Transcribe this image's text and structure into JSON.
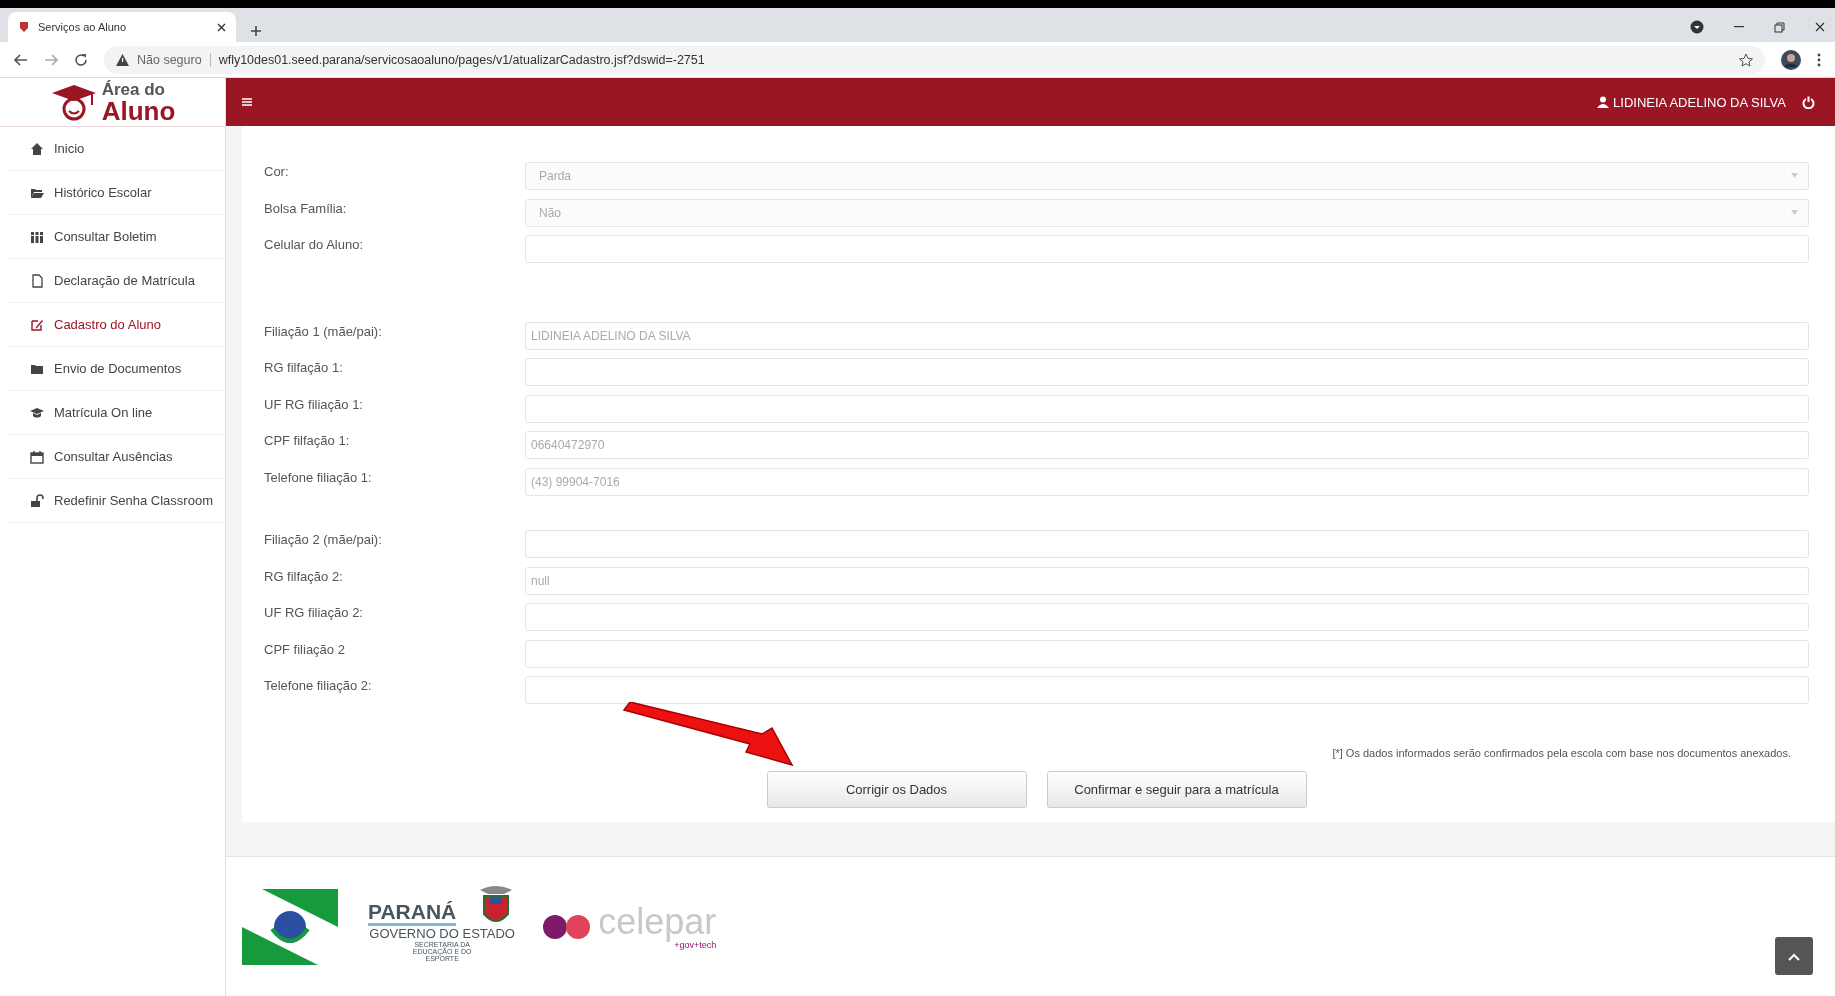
{
  "browser": {
    "tab_title": "Serviços ao Aluno",
    "security": "Não seguro",
    "url": "wfly10des01.seed.parana/servicosaoaluno/pages/v1/atualizarCadastro.jsf?dswid=-2751"
  },
  "logo": {
    "line1": "Área do",
    "line2": "Aluno"
  },
  "header": {
    "user_name": "LIDINEIA ADELINO DA SILVA"
  },
  "sidebar": {
    "items": [
      {
        "label": "Inicio",
        "selected": false
      },
      {
        "label": "Histórico Escolar",
        "selected": false
      },
      {
        "label": "Consultar Boletim",
        "selected": false
      },
      {
        "label": "Declaração de Matrícula",
        "selected": false
      },
      {
        "label": "Cadastro do Aluno",
        "selected": true
      },
      {
        "label": "Envio de Documentos",
        "selected": false
      },
      {
        "label": "Matrícula On line",
        "selected": false
      },
      {
        "label": "Consultar Ausências",
        "selected": false
      },
      {
        "label": "Redefinir Senha Classroom",
        "selected": false
      }
    ]
  },
  "form": {
    "sections": [
      [
        {
          "label": "Cor:",
          "kind": "select",
          "value": "Parda"
        },
        {
          "label": "Bolsa Família:",
          "kind": "select",
          "value": "Não"
        },
        {
          "label": "Celular do Aluno:",
          "kind": "text"
        }
      ],
      [
        {
          "label": "Filiação 1 (mãe/pai):",
          "kind": "text",
          "value": "LIDINEIA ADELINO DA SILVA"
        },
        {
          "label": "RG filfação 1:",
          "kind": "text"
        },
        {
          "label": "UF RG filiação 1:",
          "kind": "text"
        },
        {
          "label": "CPF filfação 1:",
          "kind": "text",
          "value": "06640472970"
        },
        {
          "label": "Telefone filiação 1:",
          "kind": "text",
          "value": "(43) 99904-7016"
        }
      ],
      [
        {
          "label": "Filiação 2 (mãe/pai):",
          "kind": "text"
        },
        {
          "label": "RG filfação 2:",
          "kind": "text",
          "value": "null"
        },
        {
          "label": "UF RG filiação 2:",
          "kind": "text"
        },
        {
          "label": "CPF filiação 2",
          "kind": "text"
        },
        {
          "label": "Telefone filiação 2:",
          "kind": "text"
        }
      ]
    ],
    "note": "[*] Os dados informados serão confirmados pela escola com base nos documentos anexados.",
    "buttons": [
      "Corrigir os Dados",
      "Confirmar e seguir para a matrícula"
    ]
  },
  "footer": {
    "parana": "PARANÁ",
    "governo": "GOVERNO DO ESTADO",
    "secretaria": "SECRETARIA DA EDUCAÇÃO E DO ESPORTE",
    "celepar": "celepar",
    "tagline": "+gov+tech"
  }
}
